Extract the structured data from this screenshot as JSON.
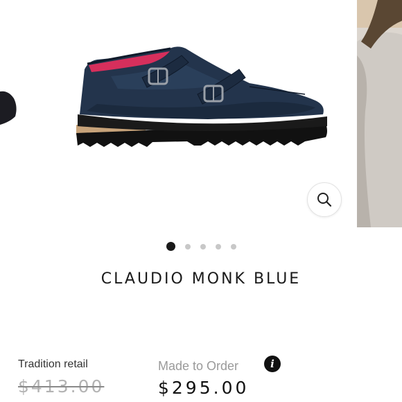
{
  "product": {
    "title": "CLAUDIO MONK BLUE",
    "image_icon": "shoe-image",
    "gallery": {
      "total_images": 5,
      "active_index": 0
    }
  },
  "pricing": {
    "retail_label": "Tradition retail",
    "retail_price": "$413.00",
    "order_label": "Made to Order",
    "sale_price": "$295.00",
    "info_icon_glyph": "i"
  },
  "icons": {
    "zoom": "search-icon",
    "info": "info-icon"
  },
  "colors": {
    "shoe_leather": "#23344c",
    "lining": "#d62f5c",
    "active_dot": "#1a1a1a",
    "inactive_dot": "#c8c8c8",
    "strike_price": "#b3b3b3"
  }
}
